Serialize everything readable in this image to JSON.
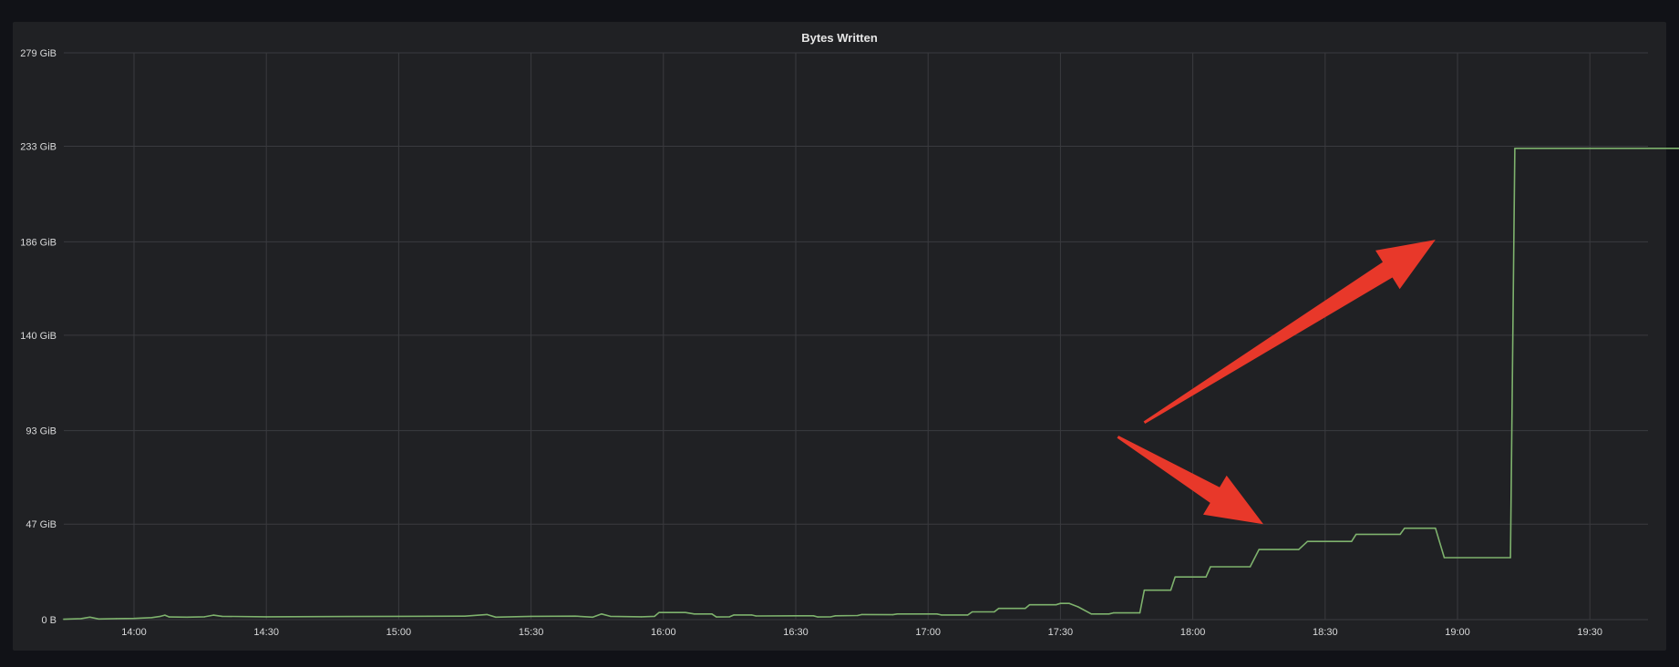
{
  "panel": {
    "title": "Bytes Written"
  },
  "colors": {
    "background": "#202124",
    "page_background": "#111217",
    "grid": "#3a3b3f",
    "series": "#7eb26d",
    "annotation_arrow": "#e8382a"
  },
  "annotations": [
    {
      "type": "arrow",
      "from": [
        "17:49",
        97
      ],
      "to": [
        "18:55",
        187
      ]
    },
    {
      "type": "arrow",
      "from": [
        "17:43",
        90
      ],
      "to": [
        "18:16",
        47
      ]
    }
  ],
  "chart_data": {
    "type": "line",
    "title": "Bytes Written",
    "xlabel": "",
    "ylabel": "",
    "grid": true,
    "legend": "none",
    "y_unit": "GiB",
    "ylim": [
      0,
      279
    ],
    "y_ticks": [
      "0 B",
      "47 GiB",
      "93 GiB",
      "140 GiB",
      "186 GiB",
      "233 GiB",
      "279 GiB"
    ],
    "y_tick_values": [
      0,
      47,
      93,
      140,
      186,
      233,
      279
    ],
    "xlim": [
      "13:44",
      "20:00"
    ],
    "x_ticks": [
      "14:00",
      "14:30",
      "15:00",
      "15:30",
      "16:00",
      "16:30",
      "17:00",
      "17:30",
      "18:00",
      "18:30",
      "19:00",
      "19:30"
    ],
    "series": [
      {
        "points": [
          [
            "13:44",
            0.2
          ],
          [
            "13:48",
            0.5
          ],
          [
            "13:50",
            1.2
          ],
          [
            "13:52",
            0.3
          ],
          [
            "13:56",
            0.5
          ],
          [
            "14:00",
            0.6
          ],
          [
            "14:04",
            1.0
          ],
          [
            "14:06",
            1.6
          ],
          [
            "14:07",
            2.2
          ],
          [
            "14:08",
            1.3
          ],
          [
            "14:12",
            1.2
          ],
          [
            "14:16",
            1.4
          ],
          [
            "14:18",
            2.2
          ],
          [
            "14:20",
            1.6
          ],
          [
            "14:30",
            1.4
          ],
          [
            "15:00",
            1.6
          ],
          [
            "15:15",
            1.7
          ],
          [
            "15:20",
            2.5
          ],
          [
            "15:22",
            1.2
          ],
          [
            "15:30",
            1.6
          ],
          [
            "15:40",
            1.7
          ],
          [
            "15:44",
            1.2
          ],
          [
            "15:46",
            2.8
          ],
          [
            "15:48",
            1.6
          ],
          [
            "15:55",
            1.4
          ],
          [
            "15:58",
            1.6
          ],
          [
            "15:59",
            3.5
          ],
          [
            "16:05",
            3.5
          ],
          [
            "16:07",
            2.8
          ],
          [
            "16:11",
            2.8
          ],
          [
            "16:12",
            1.3
          ],
          [
            "16:15",
            1.4
          ],
          [
            "16:16",
            2.3
          ],
          [
            "16:20",
            2.3
          ],
          [
            "16:21",
            1.8
          ],
          [
            "16:30",
            1.9
          ],
          [
            "16:34",
            1.9
          ],
          [
            "16:35",
            1.3
          ],
          [
            "16:38",
            1.4
          ],
          [
            "16:39",
            1.9
          ],
          [
            "16:44",
            2.0
          ],
          [
            "16:45",
            2.5
          ],
          [
            "16:52",
            2.4
          ],
          [
            "16:53",
            2.8
          ],
          [
            "17:02",
            2.8
          ],
          [
            "17:03",
            2.3
          ],
          [
            "17:09",
            2.3
          ],
          [
            "17:10",
            3.8
          ],
          [
            "17:15",
            3.8
          ],
          [
            "17:16",
            5.5
          ],
          [
            "17:22",
            5.5
          ],
          [
            "17:23",
            7.3
          ],
          [
            "17:29",
            7.3
          ],
          [
            "17:30",
            8.0
          ],
          [
            "17:32",
            8.0
          ],
          [
            "17:34",
            6.3
          ],
          [
            "17:37",
            2.8
          ],
          [
            "17:41",
            2.8
          ],
          [
            "17:42",
            3.3
          ],
          [
            "17:48",
            3.3
          ],
          [
            "17:49",
            14.5
          ],
          [
            "17:55",
            14.5
          ],
          [
            "17:56",
            21.0
          ],
          [
            "18:03",
            21.0
          ],
          [
            "18:04",
            26.0
          ],
          [
            "18:13",
            26.0
          ],
          [
            "18:15",
            34.5
          ],
          [
            "18:24",
            34.5
          ],
          [
            "18:26",
            38.5
          ],
          [
            "18:36",
            38.5
          ],
          [
            "18:37",
            42.0
          ],
          [
            "18:47",
            42.0
          ],
          [
            "18:48",
            45.0
          ],
          [
            "18:55",
            45.0
          ],
          [
            "18:57",
            30.5
          ],
          [
            "19:12",
            30.5
          ],
          [
            "19:13",
            232
          ],
          [
            "20:00",
            232
          ]
        ]
      }
    ]
  }
}
